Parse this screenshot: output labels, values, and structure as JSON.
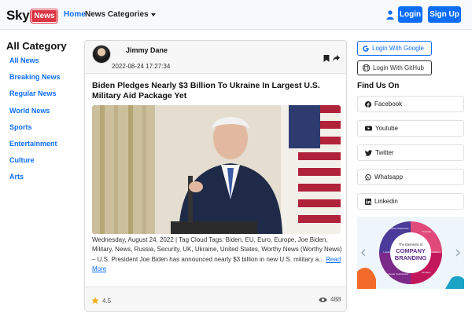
{
  "nav": {
    "brand_sky": "Sky",
    "brand_news": "News",
    "home": "Home",
    "categories": "News Categories",
    "login": "Login",
    "signup": "Sign Up"
  },
  "sidebar": {
    "title": "All Category",
    "items": [
      "All News",
      "Breaking News",
      "Regular News",
      "World News",
      "Sports",
      "Entertainment",
      "Culture",
      "Arts"
    ]
  },
  "post": {
    "author": "Jimmy Dane",
    "time": "2022-08-24 17:27:34",
    "headline": "Biden Pledges Nearly $3 Billion To Ukraine In Largest U.S. Military Aid Package Yet",
    "excerpt": "Wednesday, August 24, 2022 | Tag Cloud Tags: Biden, EU, Euro, Europe, Joe Biden, Military, News, Russia, Security, UK, Ukraine, United States, Worthy News (Worthy News) – U.S. President Joe Biden has announced nearly $3 billion in new U.S. military a...",
    "read_more": "Read More",
    "rating": "4.5",
    "views": "488"
  },
  "auth": {
    "google": "Login With Google",
    "github": "Login With GitHub"
  },
  "social": {
    "title": "Find Us On",
    "items": [
      "Facebook",
      "Youtube",
      "Twitter",
      "Whatsapp",
      "Linkedin"
    ]
  },
  "ad": {
    "line1": "The Elements of",
    "line2": "COMPANY",
    "line3": "BRANDING",
    "ring": [
      "Competitive Awareness",
      "Purpose",
      "Consistency",
      "Emotion",
      "Employee Involvement",
      "Loyalty"
    ]
  },
  "colors": {
    "primary": "#0d6efd",
    "brand_red": "#dc3545"
  }
}
